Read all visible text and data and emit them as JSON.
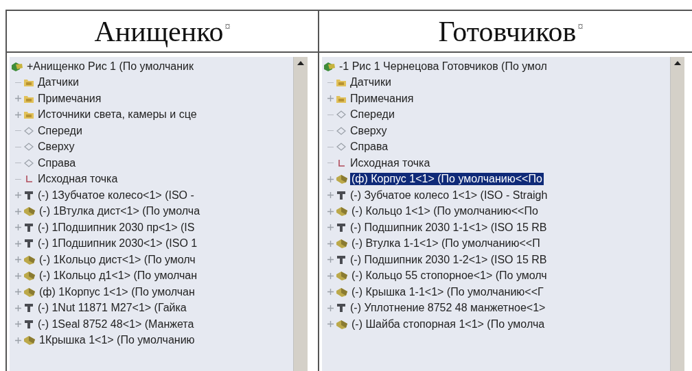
{
  "columns": [
    {
      "heading": "Анищенко",
      "end_mark": "¤",
      "tree": {
        "label": "+Анищенко Рис 1  (По умолчаник",
        "kind": "assembly",
        "selected": false,
        "children": [
          {
            "label": "Датчики",
            "kind": "folder",
            "collapsed": false,
            "selected": false
          },
          {
            "label": "Примечания",
            "kind": "folder",
            "collapsed": true,
            "selected": false
          },
          {
            "label": "Источники света, камеры и сце",
            "kind": "folder",
            "collapsed": true,
            "selected": false
          },
          {
            "label": "Спереди",
            "kind": "plane",
            "collapsed": false,
            "selected": false
          },
          {
            "label": "Сверху",
            "kind": "plane",
            "collapsed": false,
            "selected": false
          },
          {
            "label": "Справа",
            "kind": "plane",
            "collapsed": false,
            "selected": false
          },
          {
            "label": "Исходная точка",
            "kind": "origin",
            "collapsed": false,
            "selected": false
          },
          {
            "label": "(-) 1Зубчатое колесо<1> (ISO -",
            "kind": "toolbox",
            "collapsed": true,
            "selected": false
          },
          {
            "label": "(-) 1Втулка дист<1> (По умолча",
            "kind": "part",
            "collapsed": true,
            "selected": false
          },
          {
            "label": "(-) 1Подшипник 2030 пр<1> (IS",
            "kind": "toolbox",
            "collapsed": true,
            "selected": false
          },
          {
            "label": "(-) 1Подшипник 2030<1> (ISO 1",
            "kind": "toolbox",
            "collapsed": true,
            "selected": false
          },
          {
            "label": "(-) 1Кольцо дист<1> (По умолч",
            "kind": "part",
            "collapsed": true,
            "selected": false
          },
          {
            "label": "(-) 1Кольцо д1<1> (По умолчан",
            "kind": "part",
            "collapsed": true,
            "selected": false
          },
          {
            "label": "(ф) 1Корпус 1<1> (По умолчан",
            "kind": "part",
            "collapsed": true,
            "selected": false
          },
          {
            "label": "(-) 1Nut 11871 M27<1> (Гайка",
            "kind": "toolbox",
            "collapsed": true,
            "selected": false
          },
          {
            "label": "(-) 1Seal 8752 48<1> (Манжета",
            "kind": "toolbox",
            "collapsed": true,
            "selected": false
          },
          {
            "label": "1Крышка 1<1> (По умолчанию",
            "kind": "part",
            "collapsed": true,
            "selected": false
          }
        ]
      }
    },
    {
      "heading": "Готовчиков",
      "end_mark": "¤",
      "tree": {
        "label": "-1 Рис 1 Чернецова Готовчиков  (По умол",
        "kind": "assembly",
        "selected": false,
        "children": [
          {
            "label": "Датчики",
            "kind": "folder",
            "collapsed": false,
            "selected": false
          },
          {
            "label": "Примечания",
            "kind": "folder",
            "collapsed": true,
            "selected": false
          },
          {
            "label": "Спереди",
            "kind": "plane",
            "collapsed": false,
            "selected": false
          },
          {
            "label": "Сверху",
            "kind": "plane",
            "collapsed": false,
            "selected": false
          },
          {
            "label": "Справа",
            "kind": "plane",
            "collapsed": false,
            "selected": false
          },
          {
            "label": "Исходная точка",
            "kind": "origin",
            "collapsed": false,
            "selected": false
          },
          {
            "label": "(ф) Корпус 1<1> (По умолчанию<<По",
            "kind": "part",
            "collapsed": true,
            "selected": true
          },
          {
            "label": "(-) Зубчатое колесо 1<1> (ISO - Straigh",
            "kind": "toolbox",
            "collapsed": true,
            "selected": false
          },
          {
            "label": "(-) Кольцо 1<1> (По умолчанию<<По",
            "kind": "part",
            "collapsed": true,
            "selected": false
          },
          {
            "label": "(-) Подшипник 2030 1-1<1> (ISO 15 RB",
            "kind": "toolbox",
            "collapsed": true,
            "selected": false
          },
          {
            "label": "(-) Втулка 1-1<1> (По умолчанию<<П",
            "kind": "part",
            "collapsed": true,
            "selected": false
          },
          {
            "label": "(-) Подшипник 2030 1-2<1> (ISO 15 RB",
            "kind": "toolbox",
            "collapsed": true,
            "selected": false
          },
          {
            "label": "(-) Кольцо 55 стопорное<1> (По умолч",
            "kind": "part",
            "collapsed": true,
            "selected": false
          },
          {
            "label": "(-) Крышка 1-1<1> (По умолчанию<<Г",
            "kind": "part",
            "collapsed": true,
            "selected": false
          },
          {
            "label": "(-) Уплотнение 8752 48 манжетное<1>",
            "kind": "toolbox",
            "collapsed": true,
            "selected": false
          },
          {
            "label": "(-) Шайба стопорная 1<1> (По умолча",
            "kind": "part",
            "collapsed": true,
            "selected": false
          }
        ]
      }
    }
  ]
}
